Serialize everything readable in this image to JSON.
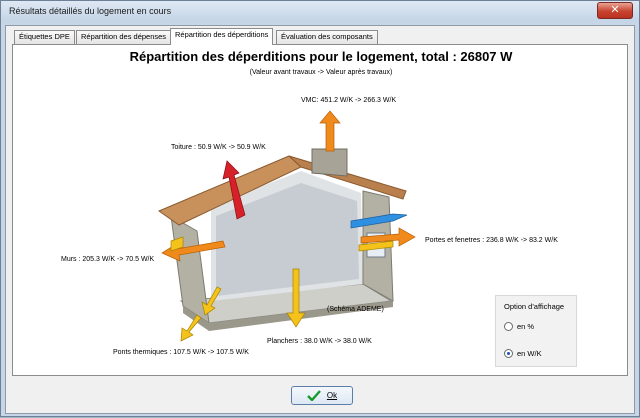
{
  "window": {
    "title": "Résultats détaillés du logement en cours",
    "close_glyph": "✕"
  },
  "tabs": [
    {
      "label": "Étiquettes DPE",
      "active": false
    },
    {
      "label": "Répartition des dépenses",
      "active": false
    },
    {
      "label": "Répartition des déperditions",
      "active": true
    },
    {
      "label": "Évaluation des composants",
      "active": false
    }
  ],
  "panel": {
    "title": "Répartition des déperditions pour le logement, total : 26807 W",
    "subtitle": "(Valeur avant travaux -> Valeur après travaux)",
    "labels": {
      "vmc": "VMC: 451.2 W/K -> 266.3 W/K",
      "toiture": "Toiture : 50.9 W/K -> 50.9 W/K",
      "murs": "Murs : 205.3 W/K -> 70.5 W/K",
      "portes": "Portes et fenetres : 236.8 W/K -> 83.2 W/K",
      "planchers": "Planchers : 38.0 W/K -> 38.0 W/K",
      "ponts": "Ponts thermiques : 107.5 W/K -> 107.5 W/K",
      "schema": "(Schéma ADEME)"
    }
  },
  "options": {
    "title": "Option d'affichage",
    "items": [
      {
        "label": "en %",
        "checked": false
      },
      {
        "label": "en W/K",
        "checked": true
      }
    ]
  },
  "ok_button": {
    "label": "Ok",
    "icon": "checkmark-icon"
  },
  "colors": {
    "arrow_orange": "#f08a1c",
    "arrow_red": "#d6202a",
    "arrow_yellow": "#f4c21b",
    "arrow_blue": "#2f8fe0"
  }
}
